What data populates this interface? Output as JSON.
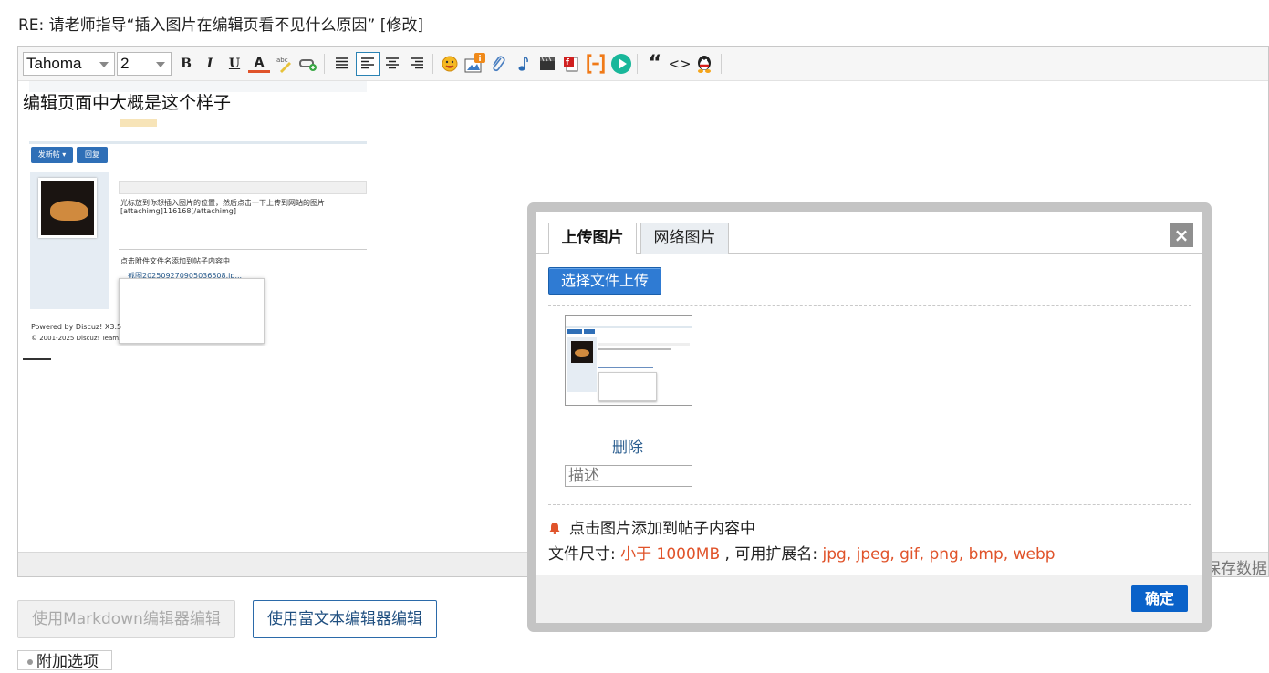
{
  "page": {
    "title": "RE: 请老师指导“插入图片在编辑页看不见什么原因” [修改]"
  },
  "toolbar": {
    "font_family": "Tahoma",
    "font_size": "2",
    "bold_label": "B",
    "italic_label": "I",
    "underline_label": "U",
    "font_color_label": "A",
    "quote_label": "“",
    "code_label": "<>"
  },
  "editor": {
    "content_text": "编辑页面中大概是这个样子",
    "save_data_label": "保存数据"
  },
  "embedded_screenshot": {
    "button_post": "发新帖 ▾",
    "button_reply": "回复",
    "line1": "光标放到你想插入图片的位置，然后点击一下上传到网站的图片",
    "line2": "[attachimg]116168[/attachimg]",
    "line3": "点击附件文件名添加到帖子内容中",
    "attachment_name": "截图20250927090503650​8.jp...",
    "powered_by": "Powered by Discuz! X3.5",
    "copyright": "© 2001-2025 Discuz! Team."
  },
  "buttons": {
    "markdown_label": "使用Markdown编辑器编辑",
    "richtext_label": "使用富文本编辑器编辑",
    "addon_label": "附加选项"
  },
  "dialog": {
    "tab_upload": "上传图片",
    "tab_web": "网络图片",
    "close_label": "×",
    "choose_file_label": "选择文件上传",
    "delete_label": "删除",
    "description_placeholder": "描述",
    "hint_text": "点击图片添加到帖子内容中",
    "file_size_prefix": "文件尺寸: ",
    "file_size_value": "小于 1000MB",
    "ext_prefix": " , 可用扩展名: ",
    "ext_value": "jpg, jpeg, gif, png, bmp, webp",
    "ok_label": "确定"
  },
  "colors": {
    "accent_blue": "#0a62c9",
    "warning_red": "#e0532a"
  }
}
